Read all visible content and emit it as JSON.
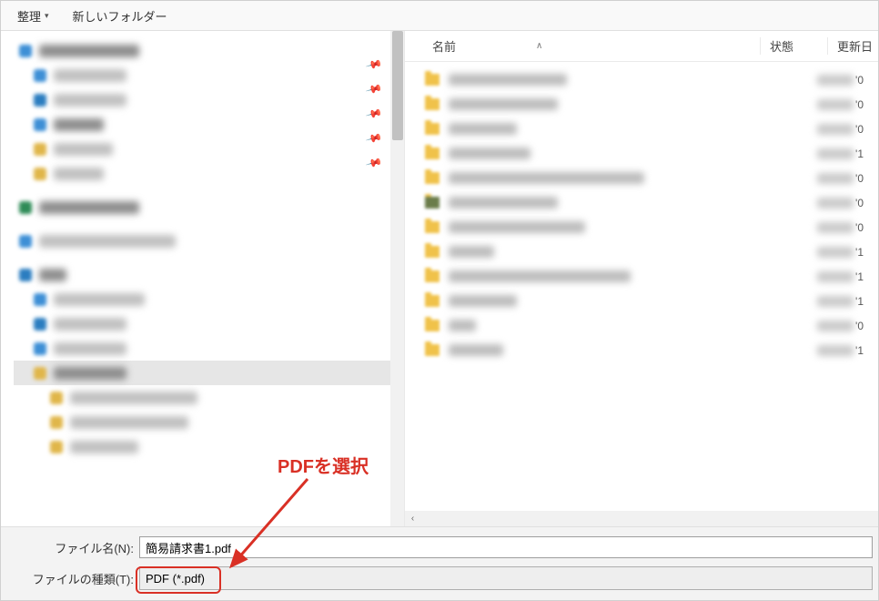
{
  "toolbar": {
    "organize": "整理",
    "new_folder": "新しいフォルダー"
  },
  "files_header": {
    "name": "名前",
    "state": "状態",
    "date": "更新日"
  },
  "file_date_suffixes": [
    "'0",
    "'0",
    "'0",
    "'1",
    "'0",
    "'0",
    "'0",
    "'1",
    "'1",
    "'1",
    "'0",
    "'1"
  ],
  "file_name_widths": [
    130,
    120,
    75,
    90,
    215,
    120,
    150,
    50,
    200,
    75,
    30,
    60
  ],
  "bottom": {
    "filename_label": "ファイル名(N):",
    "filetype_label": "ファイルの種類(T):",
    "filename_value": "簡易請求書1.pdf",
    "filetype_value": "PDF (*.pdf)"
  },
  "annotation": {
    "text": "PDFを選択"
  }
}
